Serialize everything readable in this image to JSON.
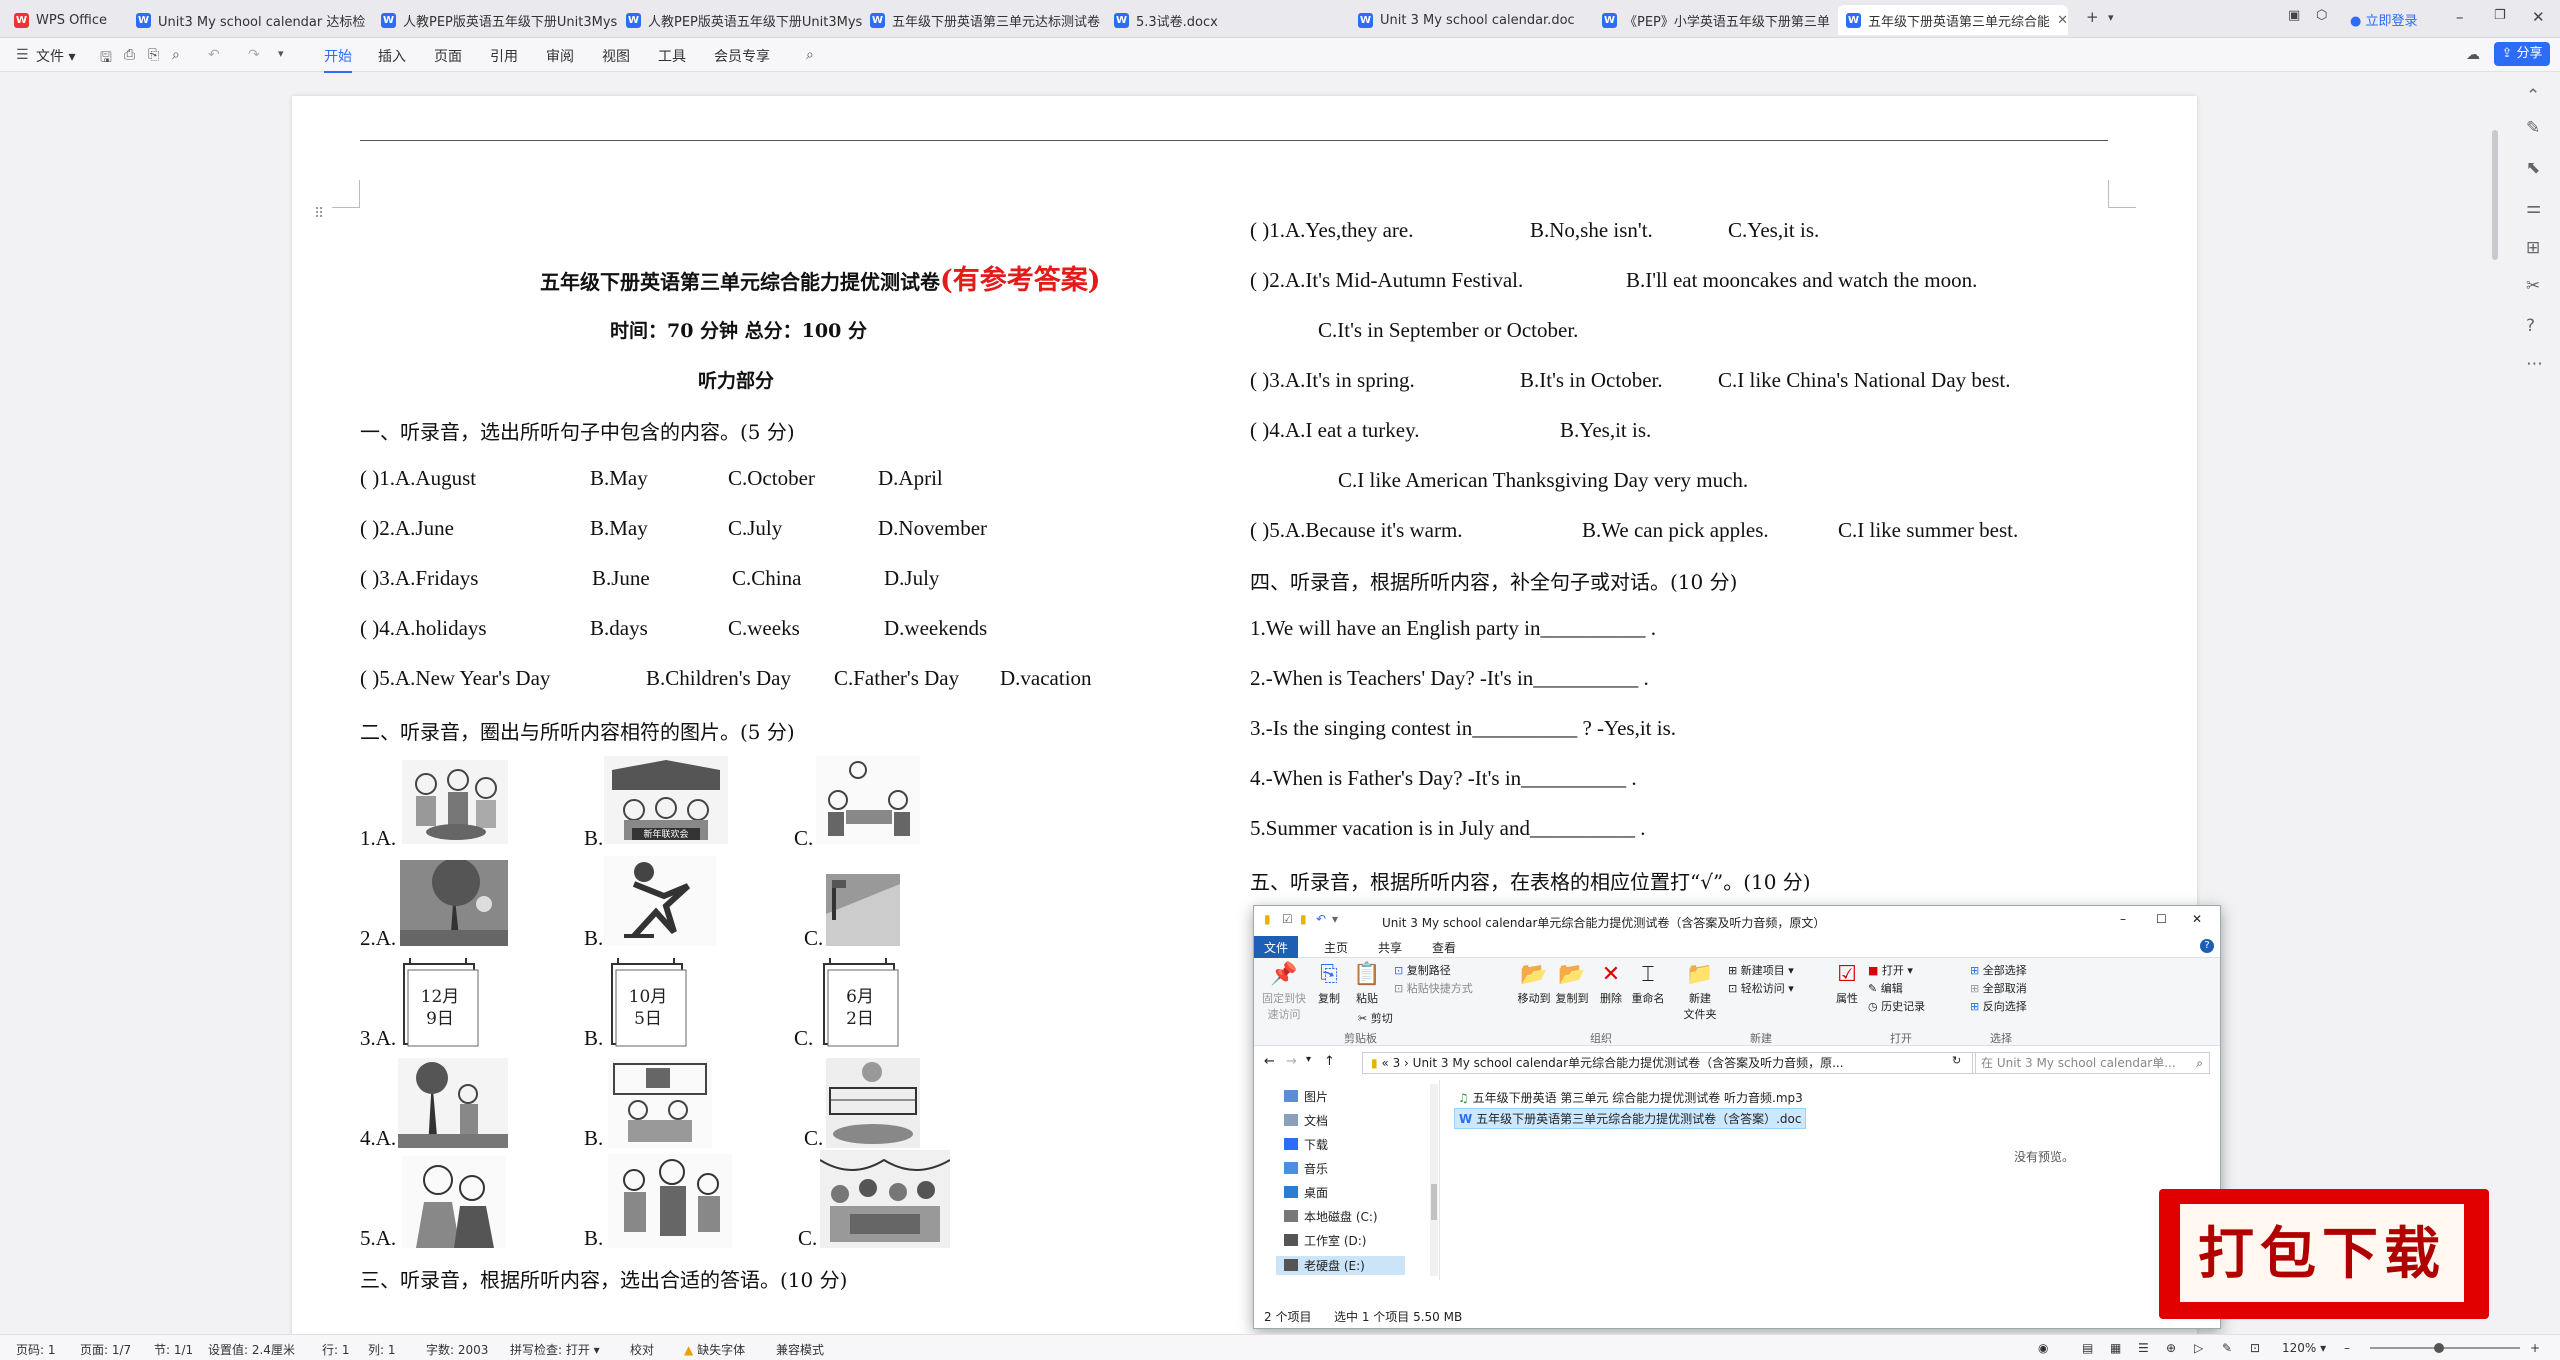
{
  "tabs": [
    {
      "label": "WPS Office",
      "icon": "wps-logo-icon"
    },
    {
      "label": "Unit3 My school calendar 达标检",
      "icon": "word-doc-icon"
    },
    {
      "label": "人教PEP版英语五年级下册Unit3Mys",
      "icon": "word-doc-icon"
    },
    {
      "label": "人教PEP版英语五年级下册Unit3Mys",
      "icon": "word-doc-icon"
    },
    {
      "label": "五年级下册英语第三单元达标测试卷",
      "icon": "word-doc-icon"
    },
    {
      "label": "5.3试卷.docx",
      "icon": "word-doc-icon"
    },
    {
      "label": "Unit 3 My school calendar.doc",
      "icon": "word-doc-icon"
    },
    {
      "label": "《PEP》小学英语五年级下册第三单",
      "icon": "word-doc-icon"
    },
    {
      "label": "五年级下册英语第三单元综合能",
      "icon": "word-doc-icon"
    }
  ],
  "login_label": "立即登录",
  "menu": {
    "file": "文件",
    "items": [
      "开始",
      "插入",
      "页面",
      "引用",
      "审阅",
      "视图",
      "工具",
      "会员专享"
    ],
    "share": "分享"
  },
  "doc": {
    "title": "五年级下册英语第三单元综合能力提优测试卷",
    "title_red": "(有参考答案)",
    "time_line": "时间：70 分钟    总分：100 分",
    "section_listening": "听力部分",
    "q1_heading": "一、听录音，选出所听句子中包含的内容。(5 分)",
    "q1": [
      {
        "num": "(          )1.A.August",
        "b": "B.May",
        "c": "C.October",
        "d": "D.April"
      },
      {
        "num": "(          )2.A.June",
        "b": "B.May",
        "c": "C.July",
        "d": "D.November"
      },
      {
        "num": "(          )3.A.Fridays",
        "b": "B.June",
        "c": "C.China",
        "d": "D.July"
      },
      {
        "num": "(          )4.A.holidays",
        "b": "B.days",
        "c": "C.weeks",
        "d": "D.weekends"
      },
      {
        "num": "(          )5.A.New Year's Day",
        "b": "B.Children's Day",
        "c": "C.Father's Day",
        "d": "D.vacation"
      }
    ],
    "q2_heading": "二、听录音，圈出与所听内容相符的图片。(5 分)",
    "q2_labels": [
      "1.A.",
      "B.",
      "C.",
      "2.A.",
      "B.",
      "C.",
      "3.A.",
      "B.",
      "C.",
      "4.A.",
      "B.",
      "C.",
      "5.A.",
      "B.",
      "C."
    ],
    "calendar_pics": [
      {
        "month": "12月",
        "day": "9日"
      },
      {
        "month": "10月",
        "day": "5日"
      },
      {
        "month": "6月",
        "day": "2日"
      }
    ],
    "banner_text": "新年联欢会",
    "q3_heading": "三、听录音，根据所听内容，选出合适的答语。(10 分)",
    "q3": [
      {
        "a": "(          )1.A.Yes,they are.",
        "b": "B.No,she isn't.",
        "c": "C.Yes,it is."
      },
      {
        "a": "(          )2.A.It's Mid-Autumn Festival.",
        "b": "B.I'll eat mooncakes and watch the moon.",
        "c": ""
      },
      {
        "a": "C.It's in September or October.",
        "b": "",
        "c": ""
      },
      {
        "a": "(          )3.A.It's in spring.",
        "b": "B.It's in October.",
        "c": "C.I like China's National Day best."
      },
      {
        "a": "(          )4.A.I eat a turkey.",
        "b": "B.Yes,it is.",
        "c": ""
      },
      {
        "a": "C.I like American Thanksgiving Day very much.",
        "b": "",
        "c": ""
      },
      {
        "a": "(          )5.A.Because it's warm.",
        "b": "B.We can pick apples.",
        "c": "C.I like summer best."
      }
    ],
    "q4_heading": "四、听录音，根据所听内容，补全句子或对话。(10 分)",
    "q4": [
      "1.We will have an English party in__________ .",
      "2.-When is Teachers' Day?      -It's in__________ .",
      "3.-Is the singing contest in__________ ?    -Yes,it is.",
      "4.-When is Father's Day?      -It's in__________ .",
      "5.Summer vacation is in July and__________ ."
    ],
    "q5_heading": "五、听录音，根据所听内容，在表格的相应位置打“√”。(10 分)"
  },
  "explorer": {
    "title": "Unit 3 My school calendar单元综合能力提优测试卷（含答案及听力音频，原文）",
    "tabs": [
      "文件",
      "主页",
      "共享",
      "查看"
    ],
    "ribbon": {
      "pin": "固定到快\n速访问",
      "copy": "复制",
      "paste": "粘贴",
      "copy_path": "复制路径",
      "paste_shortcut": "粘贴快捷方式",
      "cut": "剪切",
      "move_to": "移动到",
      "copy_to": "复制到",
      "delete": "删除",
      "rename": "重命名",
      "new_folder": "新建\n文件夹",
      "new_item": "新建项目",
      "easy_access": "轻松访问",
      "properties": "属性",
      "open": "打开",
      "edit": "编辑",
      "history": "历史记录",
      "select_all": "全部选择",
      "select_none": "全部取消",
      "invert": "反向选择",
      "groups": [
        "剪贴板",
        "组织",
        "新建",
        "打开",
        "选择"
      ]
    },
    "address": "«  3  ›  Unit 3 My school calendar单元综合能力提优测试卷（含答案及听力音频，原...",
    "search_placeholder": "在 Unit 3 My school calendar单...",
    "nav": [
      "图片",
      "文档",
      "下载",
      "音乐",
      "桌面",
      "本地磁盘 (C:)",
      "工作室 (D:)",
      "老硬盘 (E:)"
    ],
    "files": [
      {
        "name": "五年级下册英语 第三单元 综合能力提优测试卷 听力音频.mp3",
        "type": "audio"
      },
      {
        "name": "五年级下册英语第三单元综合能力提优测试卷（含答案）.doc",
        "type": "doc"
      }
    ],
    "no_preview": "没有预览。",
    "status_items": "2 个项目",
    "status_selected": "选中 1 个项目  5.50 MB"
  },
  "download_badge": "打包下载",
  "statusbar": {
    "page": "页码: 1",
    "pages": "页面: 1/7",
    "section": "节: 1/1",
    "setting": "设置值: 2.4厘米",
    "row": "行: 1",
    "col": "列: 1",
    "words": "字数: 2003",
    "spell": "拼写检查: 打开",
    "proof": "校对",
    "missing_font": "缺失字体",
    "compat": "兼容模式",
    "zoom": "120%"
  },
  "colors": {
    "accent": "#2d6cf6",
    "red": "#e41b1b",
    "explorer_blue": "#1c5fb5"
  }
}
